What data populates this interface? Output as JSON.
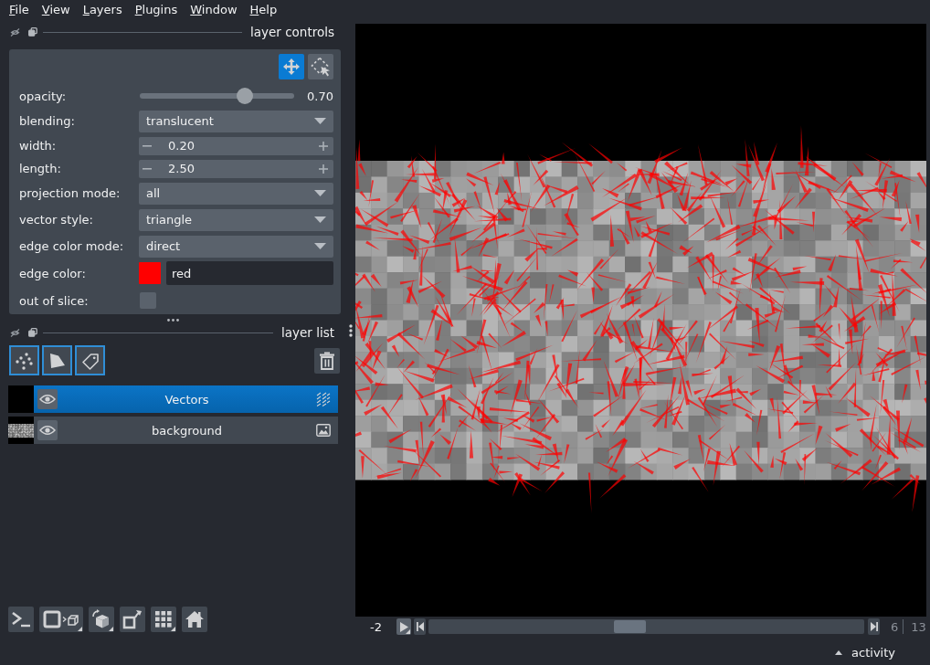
{
  "menu": [
    "File",
    "View",
    "Layers",
    "Plugins",
    "Window",
    "Help"
  ],
  "layer_controls": {
    "title": "layer controls",
    "mode_buttons": [
      {
        "kind": "pan_zoom",
        "selected": true
      },
      {
        "kind": "transform",
        "selected": false
      }
    ],
    "rows": [
      {
        "kind": "slider",
        "label": "opacity:",
        "level": 0.7,
        "value": "0.70"
      },
      {
        "kind": "dropdown",
        "label": "blending:",
        "value": "translucent"
      },
      {
        "kind": "spinbox",
        "label": "width:",
        "value": "0.20"
      },
      {
        "kind": "spinbox",
        "label": "length:",
        "value": "2.50"
      },
      {
        "kind": "dropdown",
        "label": "projection mode:",
        "value": "all"
      },
      {
        "kind": "dropdown",
        "label": "vector style:",
        "value": "triangle"
      },
      {
        "kind": "dropdown",
        "label": "edge color mode:",
        "value": "direct"
      },
      {
        "kind": "color",
        "label": "edge color:",
        "color": "#ff0000",
        "value": "red"
      },
      {
        "kind": "checkbox",
        "label": "out of slice:",
        "checked": false
      }
    ]
  },
  "layer_list": {
    "title": "layer list",
    "new_layer_buttons": [
      {
        "kind": "points"
      },
      {
        "kind": "shapes"
      },
      {
        "kind": "labels"
      }
    ],
    "layers": [
      {
        "name": "Vectors",
        "kind": "vectors",
        "selected": true,
        "visible": true
      },
      {
        "name": "background",
        "kind": "image",
        "selected": false,
        "visible": true
      }
    ]
  },
  "viewer_buttons": [
    {
      "kind": "console"
    },
    {
      "kind": "ndisplay"
    },
    {
      "kind": "roll"
    },
    {
      "kind": "transpose"
    },
    {
      "kind": "grid"
    },
    {
      "kind": "home"
    }
  ],
  "dims": {
    "axis_label": "-2",
    "level": 0.46,
    "current": "6",
    "total": "13"
  },
  "status_bar": {
    "activity": "activity"
  }
}
